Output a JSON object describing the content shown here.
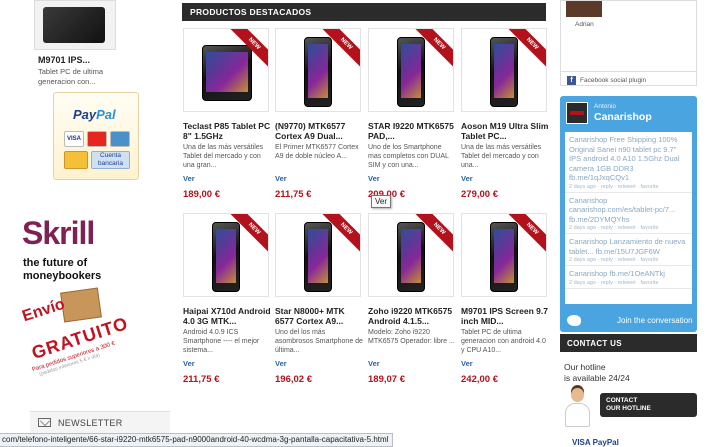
{
  "left_sidebar": {
    "featured_product": {
      "title": "M9701 IPS...",
      "description": "Tablet PC de ultima generacion con..."
    },
    "paypal": {
      "logo_a": "Pay",
      "logo_b": "Pal",
      "cards": [
        "VISA",
        "MasterCard",
        "AMEX"
      ],
      "bank_label": "Cuenta bancaria"
    },
    "skrill": {
      "logo": "Skrill",
      "tagline_1": "the future of",
      "tagline_2": "moneybookers"
    },
    "shipping_promo": {
      "line_1": "Envío",
      "line_2": "GRATUITO",
      "line_3": "Para pedidos superiores a 300 €",
      "line_4": "(pedidos inferiores 5 € x día)"
    },
    "newsletter": {
      "label": "NEWSLETTER"
    }
  },
  "main": {
    "section_title": "PRODUCTOS DESTACADOS",
    "badge_label": "NEW",
    "view_label": "Ver",
    "products": [
      {
        "name": "Teclast P85 Tablet PC 8\" 1.5GHz",
        "description": "Una de las más versátiles Tablet del mercado y con una gran...",
        "view": "Ver",
        "price": "189,00 €"
      },
      {
        "name": "(N9770) MTK6577 Cortex A9 Dual...",
        "description": "El Primer MTK6577 Cortex A9 de doble núcleo A...",
        "view": "Ver",
        "price": "211,75 €"
      },
      {
        "name": "STAR I9220 MTK6575 PAD,...",
        "description": "Uno de los Smartphone mas completos con DUAL SIM y con una...",
        "view": "Ver",
        "price": "209,00 €"
      },
      {
        "name": "Aoson M19 Ultra Slim Tablet PC...",
        "description": "Una de las más versátiles Tablet del mercado y con una...",
        "view": "Ver",
        "price": "279,00 €"
      },
      {
        "name": "Haipai X710d Android 4.0 3G MTK...",
        "description": "Android 4.0.9 ICS Smartphone ---- el mejor sistema...",
        "view": "Ver",
        "price": "211,75 €"
      },
      {
        "name": "Star N8000+ MTK 6577 Cortex A9...",
        "description": "Uno del los más asombrosos Smartphone de última...",
        "view": "Ver",
        "price": "196,02 €"
      },
      {
        "name": "Zoho i9220 MTK6575 Android 4.1.5...",
        "description": "Modelo: Zoho i9220 MTK6575 Operador: libre ...",
        "view": "Ver",
        "price": "189,07 €"
      },
      {
        "name": "M9701 IPS Screen 9.7 inch MID...",
        "description": "Tablet PC de ultima generacion con android 4.0 y CPU A10...",
        "view": "Ver",
        "price": "242,00 €"
      }
    ],
    "tooltip": "Ver"
  },
  "right_sidebar": {
    "facebook": {
      "member_name": "Adrian",
      "plugin_label": "Facebook social plugin"
    },
    "twitter": {
      "user_name": "Antonio",
      "handle": "Canarishop",
      "tweets": [
        {
          "text": "Canarishop Free Shipping 100% Original Sanei n90 tablet pc 9.7\" IPS android 4.0 A10 1.5Ghz Dual camera 1GB DDR3 fb.me/1qJxqCQv1",
          "meta": "2 days ago · reply · retweet · favorite"
        },
        {
          "text": "Canarishop canarishop.com/es/tablet-pc/7... fb.me/2DYMQYhs",
          "meta": "2 days ago · reply · retweet · favorite"
        },
        {
          "text": "Canarishop Lanzamiento de nueva tablet... fb.me/15U7JGF6W",
          "meta": "2 days ago · reply · retweet · favorite"
        },
        {
          "text": "Canarishop fb.me/1OeANTkj",
          "meta": "2 days ago · reply · retweet · favorite"
        }
      ],
      "join_label": "Join the conversation"
    },
    "contact": {
      "header": "CONTACT US",
      "hotline_1": "Our hotline",
      "hotline_2": "is available 24/24",
      "button_line_1": "CONTACT",
      "button_line_2": "OUR HOTLINE"
    },
    "payment_strip": "VISA  PayPal"
  },
  "status_bar": {
    "url": "com/telefono-inteligente/66-star-i9220-mtk6575-pad-n9000android-40-wcdma-3g-pantalla-capacitativa-5.html"
  },
  "colors": {
    "accent_red": "#b3121d",
    "header_dark": "#2b2b2b",
    "twitter_blue": "#4aa4e0",
    "link_blue": "#2c62a6"
  }
}
